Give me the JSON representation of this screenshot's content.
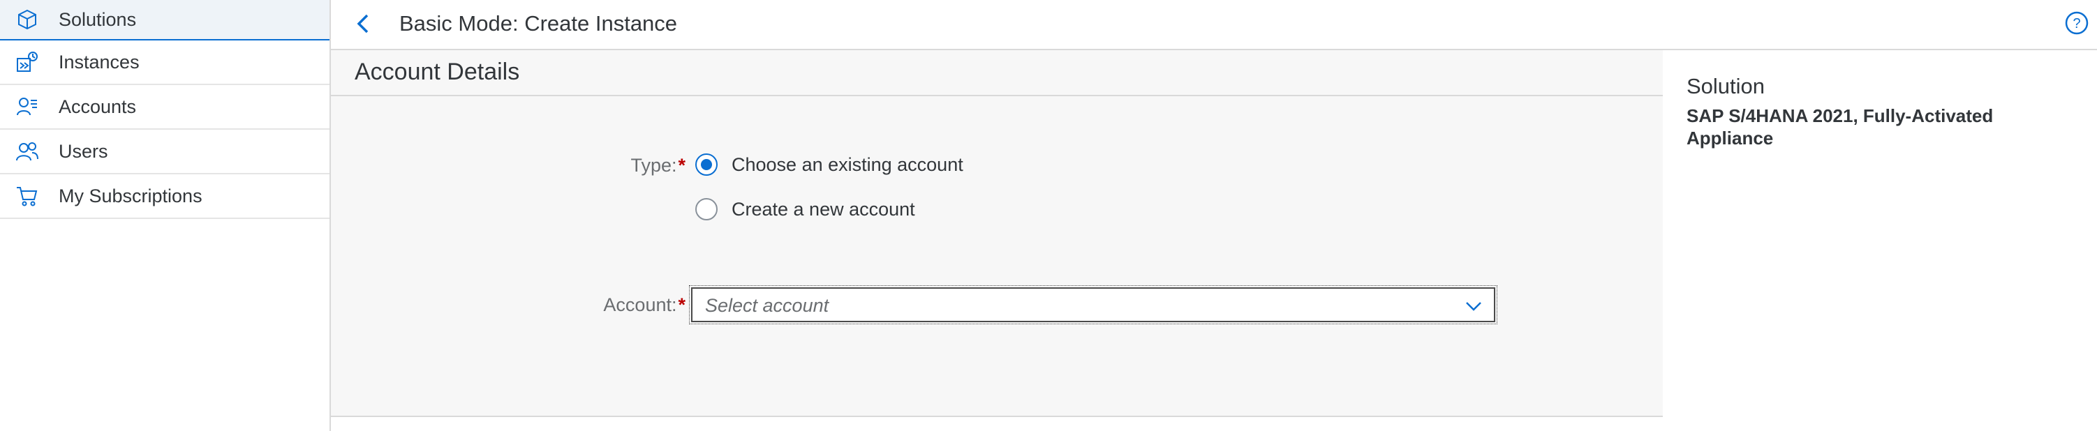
{
  "sidebar": {
    "items": [
      {
        "label": "Solutions",
        "icon": "solutions-cube-icon",
        "selected": true
      },
      {
        "label": "Instances",
        "icon": "instances-icon",
        "selected": false
      },
      {
        "label": "Accounts",
        "icon": "accounts-icon",
        "selected": false
      },
      {
        "label": "Users",
        "icon": "users-icon",
        "selected": false
      },
      {
        "label": "My Subscriptions",
        "icon": "cart-icon",
        "selected": false
      }
    ]
  },
  "header": {
    "title": "Basic Mode: Create Instance",
    "back_icon": "back-chevron-icon",
    "help_icon": "help-icon"
  },
  "form": {
    "section_title": "Account Details",
    "type_label": "Type:",
    "required_marker": "*",
    "radio_options": [
      {
        "label": "Choose an existing account",
        "checked": true
      },
      {
        "label": "Create a new account",
        "checked": false
      }
    ],
    "account_label": "Account:",
    "account_placeholder": "Select account"
  },
  "side_panel": {
    "solution_label": "Solution",
    "solution_value": "SAP S/4HANA 2021, Fully-Activated Appliance"
  },
  "colors": {
    "accent": "#0a6ed1",
    "required": "#bb0000",
    "text": "#32363a",
    "muted": "#6a6d70"
  }
}
